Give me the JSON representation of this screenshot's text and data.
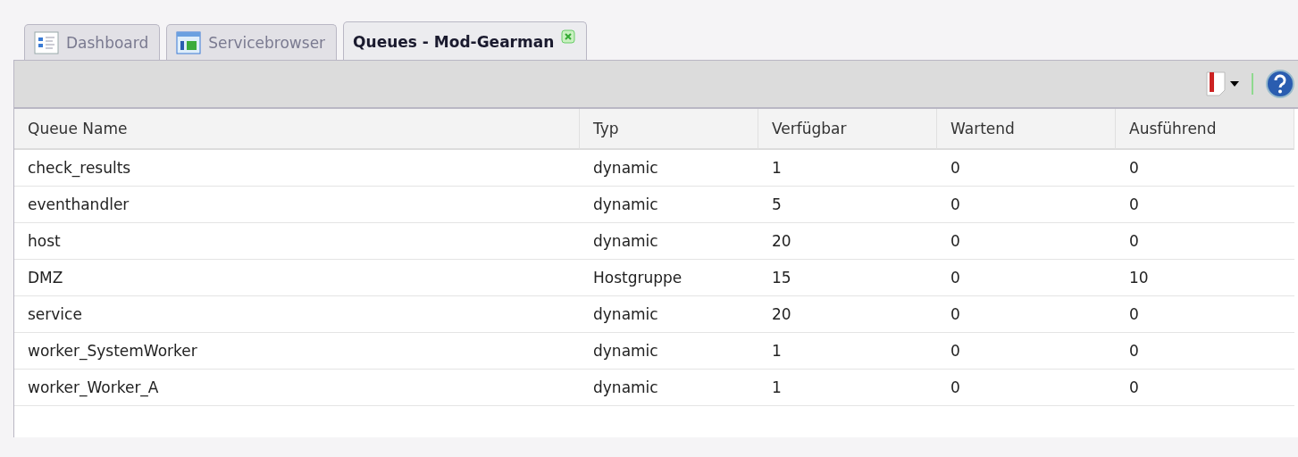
{
  "tabs": [
    {
      "label": "Dashboard",
      "kind": "dashboard",
      "selected": false
    },
    {
      "label": "Servicebrowser",
      "kind": "browser",
      "selected": false
    },
    {
      "label": "Queues - Mod-Gearman",
      "kind": "queues",
      "selected": true
    }
  ],
  "table": {
    "columns": [
      "Queue Name",
      "Typ",
      "Verfügbar",
      "Wartend",
      "Ausführend"
    ],
    "rows": [
      [
        "check_results",
        "dynamic",
        "1",
        "0",
        "0"
      ],
      [
        "eventhandler",
        "dynamic",
        "5",
        "0",
        "0"
      ],
      [
        "host",
        "dynamic",
        "20",
        "0",
        "0"
      ],
      [
        "DMZ",
        "Hostgruppe",
        "15",
        "0",
        "10"
      ],
      [
        "service",
        "dynamic",
        "20",
        "0",
        "0"
      ],
      [
        "worker_SystemWorker",
        "dynamic",
        "1",
        "0",
        "0"
      ],
      [
        "worker_Worker_A",
        "dynamic",
        "1",
        "0",
        "0"
      ]
    ]
  }
}
